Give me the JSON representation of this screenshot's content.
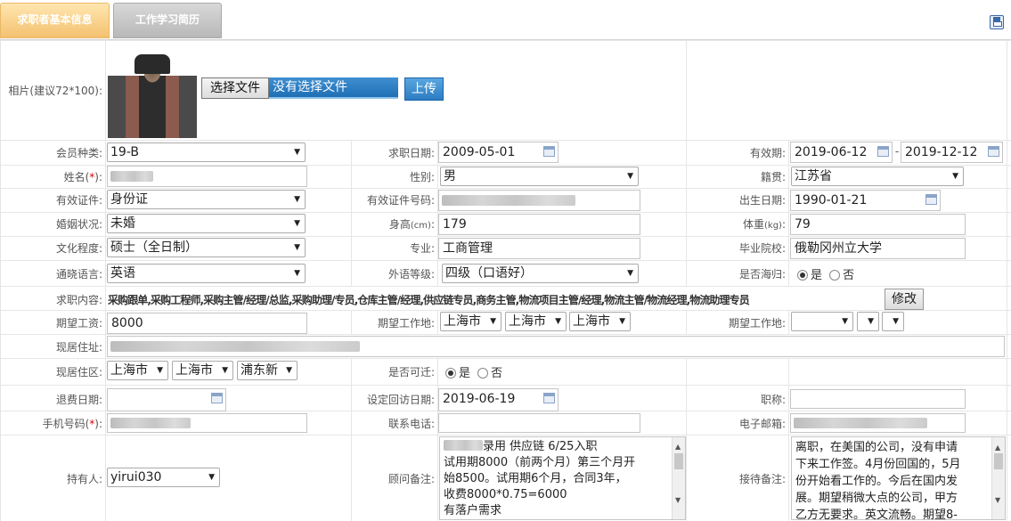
{
  "tabs": [
    {
      "label": "求职者基本信息",
      "active": true
    },
    {
      "label": "工作学习简历",
      "active": false
    }
  ],
  "photo": {
    "label": "相片(建议72*100):",
    "choose_button": "选择文件",
    "no_file_text": "没有选择文件",
    "upload_button": "上传"
  },
  "member_type": {
    "label": "会员种类:",
    "value": "19-B"
  },
  "apply_date": {
    "label": "求职日期:",
    "value": "2009-05-01"
  },
  "valid_period": {
    "label": "有效期:",
    "from": "2019-06-12",
    "sep": "-",
    "to": "2019-12-12"
  },
  "name": {
    "label_pre": "姓名(",
    "label_req": "*",
    "label_post": "):"
  },
  "gender": {
    "label": "性别:",
    "value": "男"
  },
  "native_place": {
    "label": "籍贯:",
    "value": "江苏省"
  },
  "id_type": {
    "label": "有效证件:",
    "value": "身份证"
  },
  "id_number": {
    "label": "有效证件号码:"
  },
  "birth_date": {
    "label": "出生日期:",
    "value": "1990-01-21"
  },
  "marital": {
    "label": "婚姻状况:",
    "value": "未婚"
  },
  "height": {
    "label_pre": "身高",
    "label_unit": "(cm)",
    "label_post": ":",
    "value": "179"
  },
  "weight": {
    "label_pre": "体重",
    "label_unit": "(kg)",
    "label_post": ":",
    "value": "79"
  },
  "education": {
    "label": "文化程度:",
    "value": "硕士（全日制）"
  },
  "major": {
    "label": "专业:",
    "value": "工商管理"
  },
  "school": {
    "label": "毕业院校:",
    "value": "俄勒冈州立大学"
  },
  "language": {
    "label": "通晓语言:",
    "value": "英语"
  },
  "lang_level": {
    "label": "外语等级:",
    "value": "四级（口语好）"
  },
  "returnee": {
    "label": "是否海归:",
    "yes": "是",
    "no": "否",
    "selected": "yes"
  },
  "job_content": {
    "label": "求职内容:",
    "value": "采购跟单,采购工程师,采购主管/经理/总监,采购助理/专员,仓库主管/经理,供应链专员,商务主管,物流项目主管/经理,物流主管/物流经理,物流助理专员",
    "edit_button": "修改"
  },
  "salary": {
    "label": "期望工资:",
    "value": "8000"
  },
  "work_place1": {
    "label": "期望工作地:",
    "province": "上海市",
    "city": "上海市",
    "district": "上海市"
  },
  "work_place2": {
    "label": "期望工作地:"
  },
  "address": {
    "label": "现居住址:"
  },
  "district": {
    "label": "现居住区:",
    "province": "上海市",
    "city": "上海市",
    "area": "浦东新"
  },
  "relocate": {
    "label": "是否可迁:",
    "yes": "是",
    "no": "否",
    "selected": "yes"
  },
  "refund_date": {
    "label": "退费日期:"
  },
  "visit_date": {
    "label": "设定回访日期:",
    "value": "2019-06-19"
  },
  "title": {
    "label": "职称:"
  },
  "mobile": {
    "label_pre": "手机号码(",
    "label_req": "*",
    "label_post": "):"
  },
  "phone": {
    "label": "联系电话:"
  },
  "email": {
    "label": "电子邮箱:"
  },
  "holder": {
    "label": "持有人:",
    "value": "yirui030"
  },
  "advisor_note": {
    "label": "顾问备注:",
    "lines": [
      "录用 供应链 6/25入职",
      "试用期8000（前两个月）第三个月开",
      "始8500。试用期6个月，合同3年，",
      "收费8000*0.75=6000",
      "有落户需求"
    ]
  },
  "reception_note": {
    "label": "接待备注:",
    "lines": [
      "离职，在美国的公司，没有申请",
      "下来工作签。4月份回国的，5月",
      "份开始看工作的。今后在国内发",
      "展。期望稍微大点的公司，甲方",
      "乙方无要求。英文流畅。期望8-"
    ]
  }
}
